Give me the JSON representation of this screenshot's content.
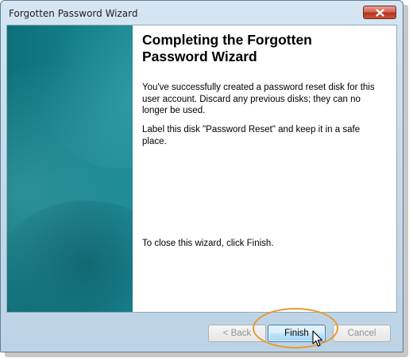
{
  "window": {
    "title": "Forgotten Password Wizard"
  },
  "main": {
    "heading": "Completing the Forgotten Password Wizard",
    "paragraph1": "You've successfully created a password reset disk for this user account. Discard any previous disks; they can no longer be used.",
    "paragraph2": "Label this disk \"Password Reset\" and keep it in a safe place.",
    "paragraph3": "To close this wizard, click Finish."
  },
  "buttons": {
    "back_label": "< Back",
    "finish_label": "Finish",
    "cancel_label": "Cancel"
  },
  "icons": {
    "close": "close-icon",
    "cursor": "mouse-pointer-icon"
  },
  "colors": {
    "side_panel": "#157f89",
    "highlight_ring": "#e89a30",
    "close_button": "#c9533e"
  }
}
